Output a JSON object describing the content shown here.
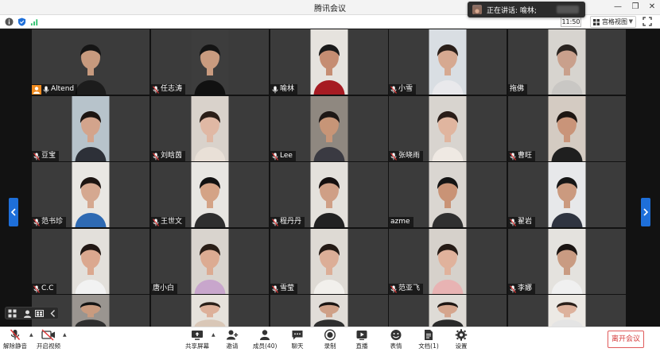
{
  "window": {
    "title": "腾讯会议"
  },
  "status": {
    "clock": "11:50",
    "view_mode": "宫格视图"
  },
  "speaking": {
    "label": "正在讲话: 喻林;"
  },
  "tiles": [
    {
      "name": "Altend",
      "host": true,
      "mic": "on",
      "bg": "#3b3b3b",
      "wall": "#3b3b3b",
      "shirt": "#1c1c1c",
      "skin": "#c79a7e",
      "hair": "#151515"
    },
    {
      "name": "任志涛",
      "mic": "off",
      "bg": "#3b3b3b",
      "wall": "#3d3d3d",
      "shirt": "#111111",
      "skin": "#c99b7f",
      "hair": "#141414"
    },
    {
      "name": "喻林",
      "mic": "on",
      "active": true,
      "bg": "#3b3b3b",
      "wall": "#e6e3de",
      "shirt": "#a61b22",
      "skin": "#c58d72",
      "hair": "#1a1a1a"
    },
    {
      "name": "小雪",
      "mic": "off",
      "bg": "#3b3b3b",
      "wall": "#d9dee3",
      "shirt": "#e9e9ec",
      "skin": "#d6a991",
      "hair": "#2a1f1a"
    },
    {
      "name": "拖佛",
      "mic": "none",
      "bg": "#3b3b3b",
      "wall": "#d7d4cf",
      "shirt": "#c9c7c4",
      "skin": "#c9a08c",
      "hair": "#2a2420"
    },
    {
      "name": "豆宝",
      "mic": "off",
      "bg": "#3b3b3b",
      "wall": "#b7c3cb",
      "shirt": "#2d3038",
      "skin": "#d3a48c",
      "hair": "#1d1512"
    },
    {
      "name": "刘晗茵",
      "mic": "off",
      "bg": "#3b3b3b",
      "wall": "#d9d2cb",
      "shirt": "#e9e0d7",
      "skin": "#e0b8a4",
      "hair": "#2b1e18"
    },
    {
      "name": "Lee",
      "mic": "off",
      "bg": "#3b3b3b",
      "wall": "#8f8880",
      "shirt": "#3a3a42",
      "skin": "#c79577",
      "hair": "#1d1715"
    },
    {
      "name": "张晓雨",
      "mic": "off",
      "bg": "#3b3b3b",
      "wall": "#d8d4cf",
      "shirt": "#efe9e3",
      "skin": "#e0b59f",
      "hair": "#2a1d18"
    },
    {
      "name": "曹旺",
      "mic": "off",
      "bg": "#3b3b3b",
      "wall": "#d4cbc2",
      "shirt": "#1f1f1f",
      "skin": "#c99479",
      "hair": "#1e1612"
    },
    {
      "name": "范书珍",
      "mic": "off",
      "bg": "#3b3b3b",
      "wall": "#e9e7e3",
      "shirt": "#2e6ab3",
      "skin": "#d5a890",
      "hair": "#1d1512"
    },
    {
      "name": "王世文",
      "mic": "off",
      "bg": "#3b3b3b",
      "wall": "#e8e6e2",
      "shirt": "#2f2f2f",
      "skin": "#d4a386",
      "hair": "#121212"
    },
    {
      "name": "程丹丹",
      "mic": "off",
      "bg": "#3b3b3b",
      "wall": "#e4e1dc",
      "shirt": "#222222",
      "skin": "#cf9f86",
      "hair": "#151010"
    },
    {
      "name": "azme",
      "mic": "none",
      "bg": "#3b3b3b",
      "wall": "#dad6d1",
      "shirt": "#303030",
      "skin": "#c99376",
      "hair": "#141414"
    },
    {
      "name": "翟岩",
      "mic": "off",
      "bg": "#3b3b3b",
      "wall": "#e7e8ea",
      "shirt": "#2f3440",
      "skin": "#cb9a7f",
      "hair": "#161616"
    },
    {
      "name": "C.C",
      "mic": "off",
      "bg": "#3b3b3b",
      "wall": "#e3e0db",
      "shirt": "#f2f2f2",
      "skin": "#dba88f",
      "hair": "#221814"
    },
    {
      "name": "唐小白",
      "mic": "none",
      "bg": "#3b3b3b",
      "wall": "#d9d4ce",
      "shirt": "#c8a6cc",
      "skin": "#dcab92",
      "hair": "#2a1e17"
    },
    {
      "name": "雪莹",
      "mic": "off",
      "bg": "#3b3b3b",
      "wall": "#dedad4",
      "shirt": "#f2f0ec",
      "skin": "#dcae97",
      "hair": "#241a15"
    },
    {
      "name": "范亚飞",
      "mic": "off",
      "bg": "#3b3b3b",
      "wall": "#d6d1cb",
      "shirt": "#e8b3b3",
      "skin": "#e0b29c",
      "hair": "#261b16"
    },
    {
      "name": "李娜",
      "mic": "off",
      "bg": "#3b3b3b",
      "wall": "#e4e2de",
      "shirt": "#f0f0f0",
      "skin": "#c99b82",
      "hair": "#1a1412"
    },
    {
      "name": "",
      "mic": "none",
      "bg": "#3b3b3b",
      "wall": "#9a9590",
      "shirt": "#2f2f2f",
      "skin": "#c99b7f",
      "hair": "#141414"
    },
    {
      "name": "",
      "mic": "none",
      "bg": "#3b3b3b",
      "wall": "#e6e2dc",
      "shirt": "#d9c7b7",
      "skin": "#ddb09a",
      "hair": "#2a1f19"
    },
    {
      "name": "",
      "mic": "none",
      "bg": "#3b3b3b",
      "wall": "#e1ddd8",
      "shirt": "#2f2f2f",
      "skin": "#cfa087",
      "hair": "#1a1412"
    },
    {
      "name": "",
      "mic": "none",
      "bg": "#3b3b3b",
      "wall": "#dedbd6",
      "shirt": "#2a2a2a",
      "skin": "#d5a58d",
      "hair": "#1d1512"
    },
    {
      "name": "",
      "mic": "none",
      "bg": "#3b3b3b",
      "wall": "#ece9e4",
      "shirt": "#e4e4e4",
      "skin": "#ddb29c",
      "hair": "#2a1f19"
    }
  ],
  "toolbar": {
    "unmute": "解除静音",
    "video": "开启视频",
    "share": "共享屏幕",
    "invite": "邀请",
    "members": "成员(40)",
    "chat": "聊天",
    "record": "录制",
    "live": "直播",
    "reaction": "表情",
    "docs": "文档(1)",
    "settings": "设置",
    "leave": "离开会议"
  },
  "colors": {
    "accent": "#1e6fd9",
    "leave": "#d63d3d",
    "host_badge": "#f08b1f",
    "active_border": "#2bbf6c"
  }
}
